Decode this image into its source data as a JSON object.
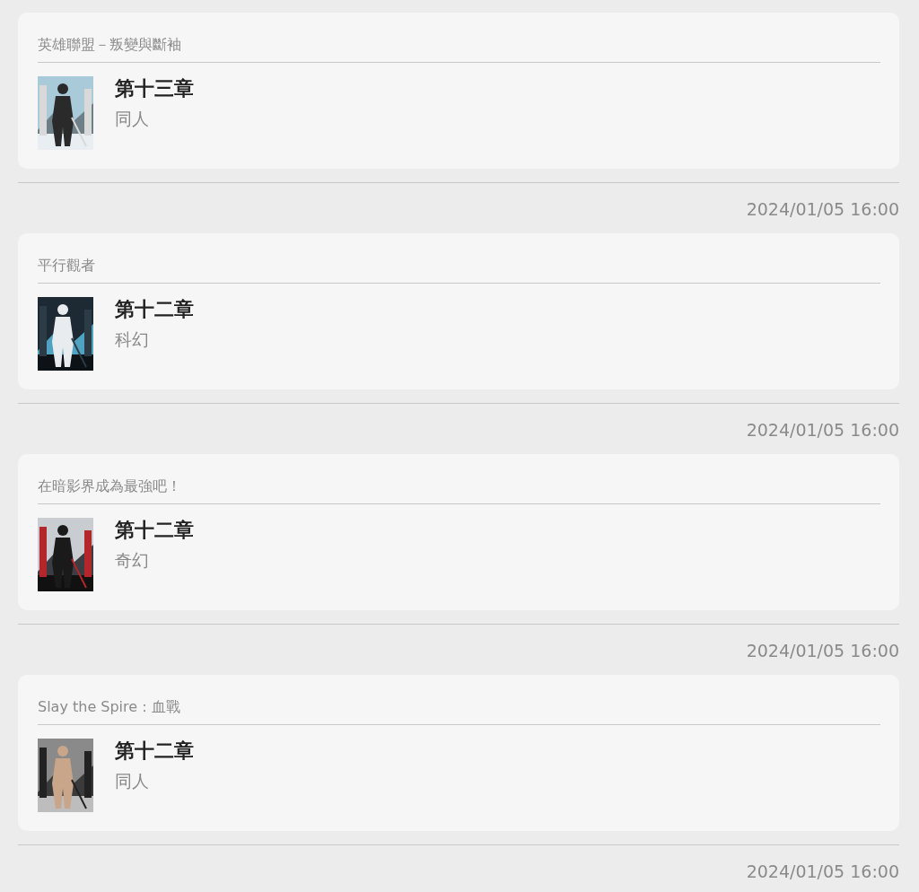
{
  "entries": [
    {
      "title": "英雄聯盟－叛變與斷袖",
      "chapter": "第十三章",
      "genre": "同人"
    },
    {
      "time": "2024/01/05 16:00",
      "title": "平行觀者",
      "chapter": "第十二章",
      "genre": "科幻"
    },
    {
      "time": "2024/01/05 16:00",
      "title": "在暗影界成為最強吧！",
      "chapter": "第十二章",
      "genre": "奇幻"
    },
    {
      "time": "2024/01/05 16:00",
      "title": "Slay the Spire：血戰",
      "chapter": "第十二章",
      "genre": "同人"
    }
  ],
  "trailing_time": "2024/01/05 16:00"
}
